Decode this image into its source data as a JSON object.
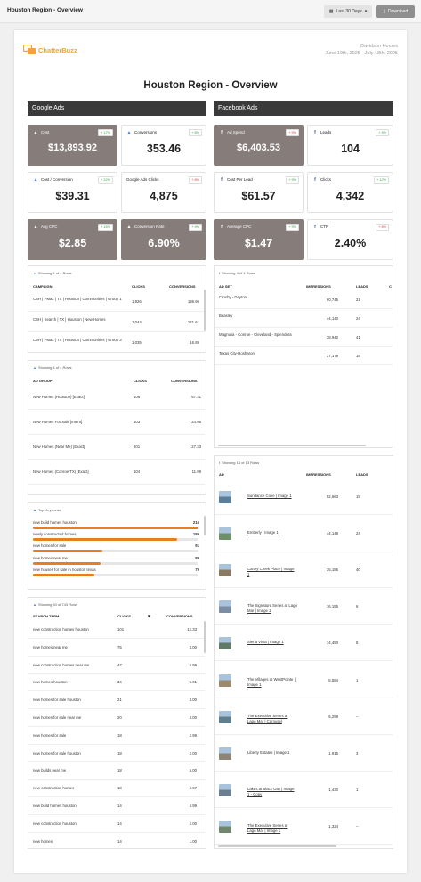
{
  "app": {
    "title": "Houston Region - Overview",
    "date_button": "Last 30 Days",
    "download_button": "Download"
  },
  "report": {
    "logo_text": "ChatterBuzz",
    "client_name": "Davidson Homes",
    "date_range": "June 19th, 2025 - July 18th, 2025",
    "title": "Houston Region - Overview",
    "google_header": "Google Ads",
    "facebook_header": "Facebook Ads"
  },
  "kpis": [
    {
      "label": "Cost",
      "value": "$13,893.92",
      "delta": "+ 17%",
      "neg": false,
      "dark": true,
      "platform": "google"
    },
    {
      "label": "Conversions",
      "value": "353.46",
      "delta": "+ 8%",
      "neg": false,
      "dark": false,
      "platform": "google"
    },
    {
      "label": "Ad Spend",
      "value": "$6,403.53",
      "delta": "+ 9%",
      "neg": true,
      "dark": true,
      "platform": "facebook"
    },
    {
      "label": "Leads",
      "value": "104",
      "delta": "+ 9%",
      "neg": false,
      "dark": false,
      "platform": "facebook"
    },
    {
      "label": "Cost / Conversion",
      "value": "$39.31",
      "delta": "+ 22%",
      "neg": false,
      "dark": false,
      "platform": "google"
    },
    {
      "label": "Google Ads Clicks",
      "value": "4,875",
      "delta": "+ 8%",
      "neg": true,
      "dark": false,
      "platform": "none"
    },
    {
      "label": "Cost Per Lead",
      "value": "$61.57",
      "delta": "+ 9%",
      "neg": false,
      "dark": false,
      "platform": "facebook"
    },
    {
      "label": "Clicks",
      "value": "4,342",
      "delta": "+ 12%",
      "neg": false,
      "dark": false,
      "platform": "facebook"
    },
    {
      "label": "Avg CPC",
      "value": "$2.85",
      "delta": "+ 16%",
      "neg": false,
      "dark": true,
      "platform": "google"
    },
    {
      "label": "Conversion Rate",
      "value": "6.90%",
      "delta": "+ 9%",
      "neg": false,
      "dark": true,
      "platform": "google"
    },
    {
      "label": "Average CPC",
      "value": "$1.47",
      "delta": "+ 9%",
      "neg": false,
      "dark": true,
      "platform": "facebook"
    },
    {
      "label": "CTR",
      "value": "2.40%",
      "delta": "+ 8%",
      "neg": true,
      "dark": false,
      "platform": "facebook"
    }
  ],
  "campaigns": {
    "showing": "Showing 4 of 4 Rows",
    "headers": [
      "CAMPAIGN",
      "CLICKS",
      "CONVERSIONS"
    ],
    "rows": [
      [
        "CSH | PMax | TX | Houston | Communities | Group 1",
        "1,926",
        "136.96"
      ],
      [
        "CSH | Search | TX | Houston | New Homes",
        "1,044",
        "121.61"
      ],
      [
        "CSH | PMax | TX | Houston | Communities | Group 3",
        "1,035",
        "16.89"
      ]
    ]
  },
  "adsets": {
    "showing": "Showing 4 of 4 Rows",
    "headers": [
      "AD SET",
      "IMPRESSIONS",
      "LEADS",
      "C"
    ],
    "rows": [
      [
        "Crosby - Dayton",
        "60,745",
        "21"
      ],
      [
        "Beasley",
        "44,140",
        "24"
      ],
      [
        "Magnolia - Conroe - Cleveland - Splendora",
        "38,942",
        "41"
      ],
      [
        "Texas City-Rosharon",
        "37,179",
        "15"
      ]
    ]
  },
  "adgroups": {
    "showing": "Showing 4 of 4 Rows",
    "headers": [
      "AD GROUP",
      "CLICKS",
      "CONVERSIONS"
    ],
    "rows": [
      [
        "New Homes (Houston) [Exact]",
        "406",
        "57.31"
      ],
      [
        "New Homes For Sale [Intent]",
        "303",
        "24.98"
      ],
      [
        "New Homes (Near Me) [Exact]",
        "201",
        "27.33"
      ],
      [
        "New Homes (Conroe,TX) [Exact]",
        "104",
        "11.99"
      ]
    ]
  },
  "ads": {
    "showing": "Showing 13 of 13 Rows",
    "headers": [
      "AD",
      "IMPRESSIONS",
      "LEADS"
    ],
    "rows": [
      [
        "Sundance Cove | Image 1",
        "52,663",
        "19"
      ],
      [
        "Emberly | Image 1",
        "44,149",
        "24"
      ],
      [
        "Caney Creek Place | Image 1",
        "35,185",
        "40"
      ],
      [
        "The Signature Series at Lago Mar | Image 1",
        "16,155",
        "6"
      ],
      [
        "Siena Vista | Image 1",
        "14,450",
        "8"
      ],
      [
        "The Villages at WestPointe | Image 1",
        "5,584",
        "1"
      ],
      [
        "The Executive Series at Lago Mar | Carousel",
        "5,298",
        "--"
      ],
      [
        "Liberty Estates | Image 1",
        "1,915",
        "3"
      ],
      [
        "Lakes at Black Oak | Image 1 - Copy",
        "1,430",
        "1"
      ],
      [
        "The Executive Series at Lago Mar | Image 1",
        "1,324",
        "--"
      ]
    ]
  },
  "keywords": {
    "title": "Top Keywords",
    "items": [
      {
        "label": "new build homes houston",
        "value": "216",
        "frac": 1.0
      },
      {
        "label": "newly constructed homes",
        "value": "189",
        "frac": 0.87
      },
      {
        "label": "new homes for sale",
        "value": "91",
        "frac": 0.42
      },
      {
        "label": "new homes near me",
        "value": "89",
        "frac": 0.41
      },
      {
        "label": "new houses for sale in houston texas",
        "value": "79",
        "frac": 0.37
      }
    ]
  },
  "search_terms": {
    "showing": "Showing 50 of 743 Rows",
    "headers": [
      "SEARCH TERM",
      "CLICKS",
      "CONVERSIONS"
    ],
    "rows": [
      [
        "new construction homes houston",
        "101",
        "12.33"
      ],
      [
        "new homes near me",
        "75",
        "3.00"
      ],
      [
        "new construction homes near me",
        "47",
        "6.99"
      ],
      [
        "new homes houston",
        "34",
        "5.01"
      ],
      [
        "new homes for sale houston",
        "21",
        "3.00"
      ],
      [
        "new homes for sale near me",
        "20",
        "4.00"
      ],
      [
        "new homes for sale",
        "18",
        "2.99"
      ],
      [
        "new homes for sale houston",
        "18",
        "2.00"
      ],
      [
        "new builds near me",
        "18",
        "5.00"
      ],
      [
        "new construction homes",
        "18",
        "2.67"
      ],
      [
        "new build homes houston",
        "14",
        "4.99"
      ],
      [
        "new construction houston",
        "14",
        "2.00"
      ],
      [
        "new homes",
        "14",
        "1.00"
      ]
    ]
  },
  "colors": {
    "accent": "#e67e22",
    "dark_card": "#867d7b",
    "section": "#3a3a3a"
  }
}
